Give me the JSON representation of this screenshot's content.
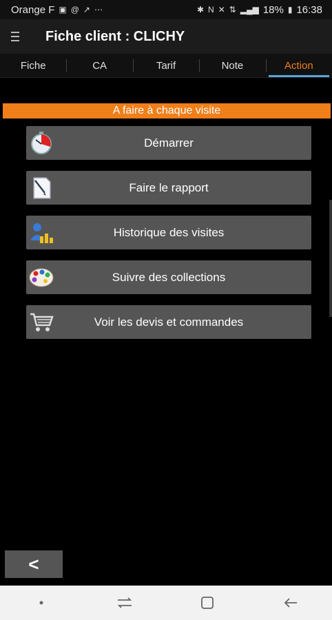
{
  "status_bar": {
    "carrier": "Orange F",
    "battery": "18%",
    "time": "16:38"
  },
  "app_bar": {
    "title": "Fiche client : CLICHY"
  },
  "tabs": [
    {
      "label": "Fiche",
      "active": false
    },
    {
      "label": "CA",
      "active": false
    },
    {
      "label": "Tarif",
      "active": false
    },
    {
      "label": "Note",
      "active": false
    },
    {
      "label": "Action",
      "active": true
    }
  ],
  "section": {
    "title": "A faire à chaque visite"
  },
  "actions": [
    {
      "label": "Démarrer",
      "icon": "stopwatch-icon"
    },
    {
      "label": "Faire le rapport",
      "icon": "report-document-icon"
    },
    {
      "label": "Historique des visites",
      "icon": "visit-history-icon"
    },
    {
      "label": "Suivre des collections",
      "icon": "palette-icon"
    },
    {
      "label": "Voir les devis et commandes",
      "icon": "shopping-cart-icon"
    }
  ],
  "back_button": {
    "label": "<"
  },
  "colors": {
    "accent": "#f07f1a",
    "tab_indicator": "#5aa6d6",
    "button_bg": "#555555",
    "background": "#000000"
  }
}
